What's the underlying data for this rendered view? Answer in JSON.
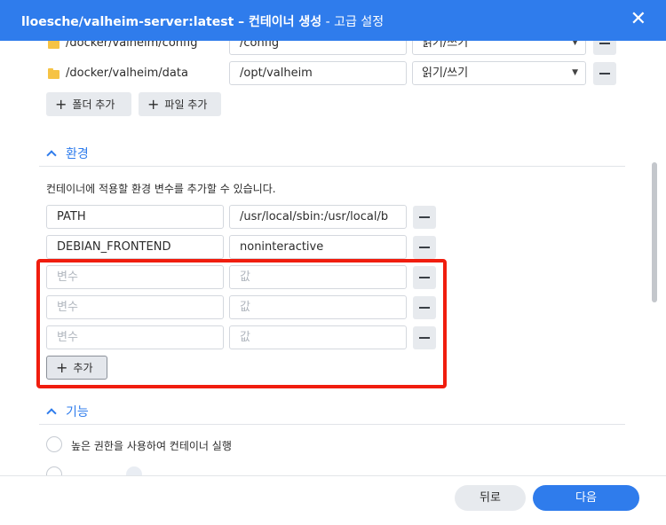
{
  "window": {
    "title": "lloesche/valheim-server:latest – 컨테이너 생성",
    "subtitle": " - 고급 설정"
  },
  "volumes": {
    "rows": [
      {
        "host_path": "/docker/valheim/config",
        "mount_path": "/config",
        "mode": "읽기/쓰기"
      },
      {
        "host_path": "/docker/valheim/data",
        "mount_path": "/opt/valheim",
        "mode": "읽기/쓰기"
      }
    ],
    "add_folder_label": "폴더 추가",
    "add_file_label": "파일 추가"
  },
  "environment": {
    "heading": "환경",
    "description": "컨테이너에 적용할 환경 변수를 추가할 수 있습니다.",
    "rows": [
      {
        "name": "PATH",
        "value": "/usr/local/sbin:/usr/local/b"
      },
      {
        "name": "DEBIAN_FRONTEND",
        "value": "noninteractive"
      }
    ],
    "name_placeholder": "변수",
    "value_placeholder": "값",
    "add_label": "추가"
  },
  "features": {
    "heading": "기능",
    "privileged_label": "높은 권한을 사용하여 컨테이너 실행"
  },
  "footer": {
    "back_label": "뒤로",
    "next_label": "다음"
  },
  "colors": {
    "accent": "#2f7cec",
    "highlight": "#f01d0e"
  }
}
